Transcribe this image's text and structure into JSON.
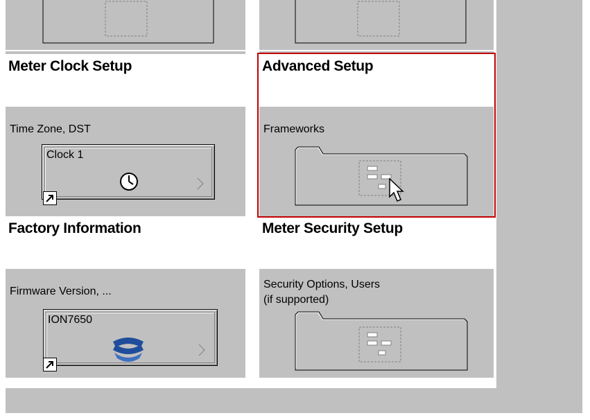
{
  "cells": {
    "meter_clock": {
      "title": "Meter Clock Setup",
      "desc": "Time Zone, DST",
      "widget_label": "Clock 1"
    },
    "advanced": {
      "title": "Advanced Setup",
      "desc": "Frameworks"
    },
    "factory": {
      "title": "Factory Information",
      "desc": "Firmware Version, ...",
      "widget_label": "ION7650"
    },
    "security": {
      "title": "Meter Security Setup",
      "desc_line1": "Security Options, Users",
      "desc_line2": "(if supported)"
    }
  },
  "selection_color": "#c00000",
  "icons": [
    "folder-icon",
    "clock-icon",
    "ion-logo-icon",
    "shortcut-arrow-icon",
    "play-arrow-icon",
    "mouse-cursor-icon"
  ]
}
